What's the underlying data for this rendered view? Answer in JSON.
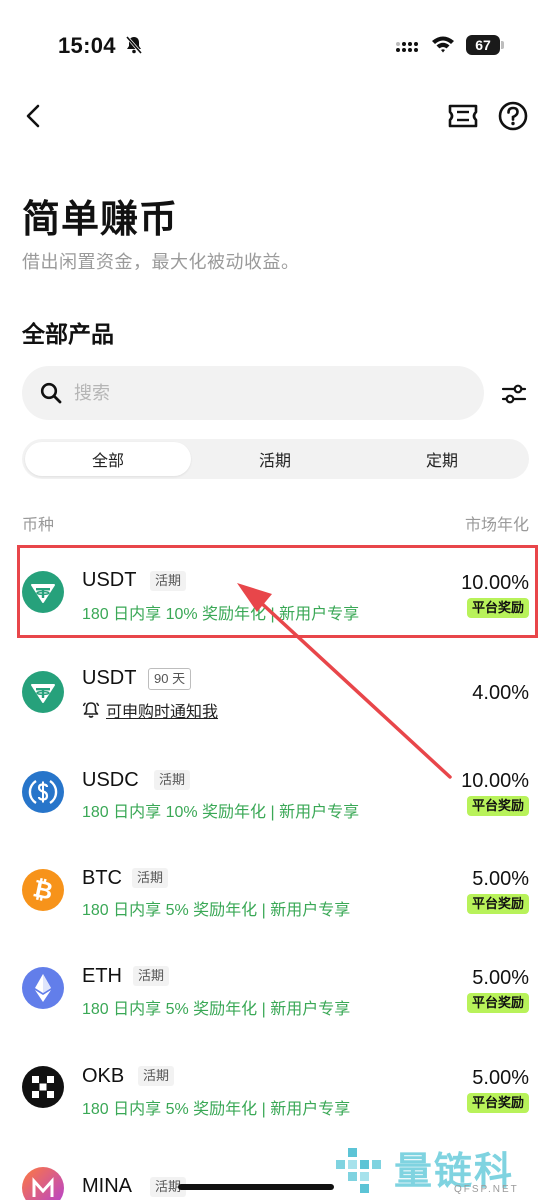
{
  "status_bar": {
    "time": "15:04",
    "battery": "67"
  },
  "header": {
    "title": "简单赚币",
    "subtitle": "借出闲置资金，最大化被动收益。"
  },
  "section": {
    "title": "全部产品"
  },
  "search": {
    "placeholder": "搜索",
    "value": ""
  },
  "tabs": [
    {
      "label": "全部",
      "active": true
    },
    {
      "label": "活期",
      "active": false
    },
    {
      "label": "定期",
      "active": false
    }
  ],
  "columns": {
    "coin": "币种",
    "apy": "市场年化"
  },
  "products": [
    {
      "coin": "USDT",
      "tag": "活期",
      "promo": "180 日内享 10% 奖励年化 | 新用户专享",
      "apy": "10.00%",
      "badge": "平台奖励",
      "icon": "tether-icon"
    },
    {
      "coin": "USDT",
      "tag": "90 天",
      "notify": "可申购时通知我",
      "apy": "4.00%",
      "icon": "tether-icon"
    },
    {
      "coin": "USDC",
      "tag": "活期",
      "promo": "180 日内享 10% 奖励年化 | 新用户专享",
      "apy": "10.00%",
      "badge": "平台奖励",
      "icon": "usdc-icon"
    },
    {
      "coin": "BTC",
      "tag": "活期",
      "promo": "180 日内享 5% 奖励年化 | 新用户专享",
      "apy": "5.00%",
      "badge": "平台奖励",
      "icon": "bitcoin-icon"
    },
    {
      "coin": "ETH",
      "tag": "活期",
      "promo": "180 日内享 5% 奖励年化 | 新用户专享",
      "apy": "5.00%",
      "badge": "平台奖励",
      "icon": "ethereum-icon"
    },
    {
      "coin": "OKB",
      "tag": "活期",
      "promo": "180 日内享 5% 奖励年化 | 新用户专享",
      "apy": "5.00%",
      "badge": "平台奖励",
      "icon": "okb-icon"
    },
    {
      "coin": "MINA",
      "tag": "活期",
      "icon": "mina-icon"
    }
  ],
  "watermark": {
    "text": "量链科技",
    "sub": "QFSP.NET"
  },
  "colors": {
    "promo_green": "#3aa856",
    "badge_lime": "#b8f25a",
    "highlight_red": "#e8464a",
    "tether_teal": "#26a17b",
    "usdc_blue": "#2775ca",
    "btc_orange": "#f7931a",
    "eth_purple": "#627eea"
  }
}
